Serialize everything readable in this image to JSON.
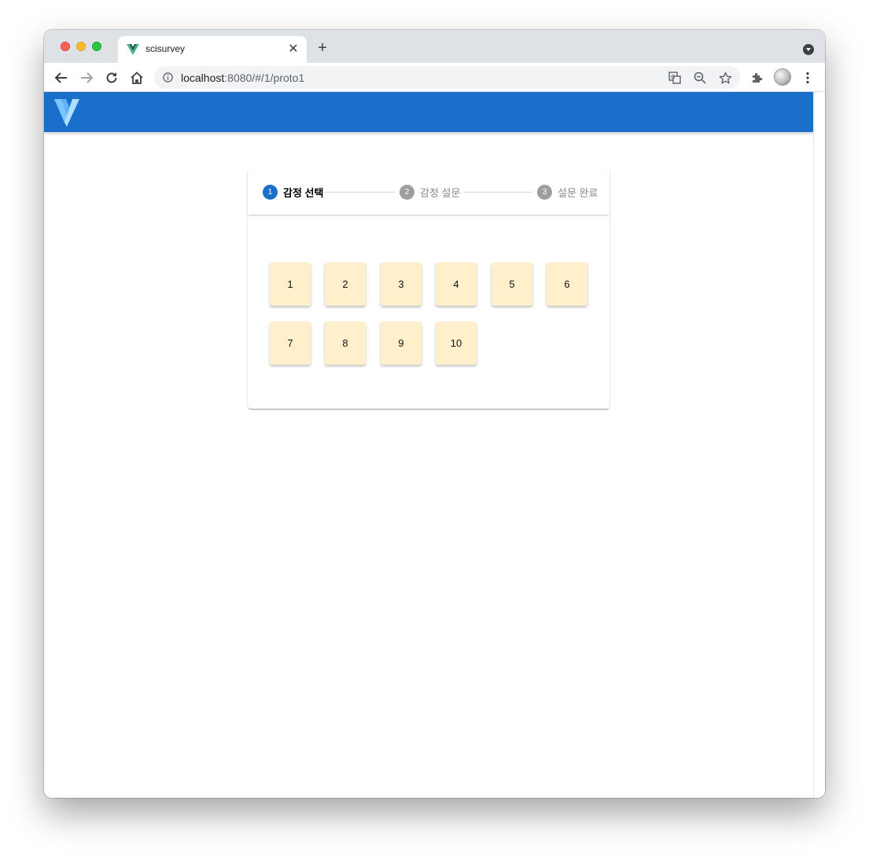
{
  "browser": {
    "tab": {
      "title": "scisurvey",
      "close_glyph": "✕"
    },
    "new_tab_glyph": "+",
    "url": {
      "host": "localhost",
      "rest": ":8080/#/1/proto1"
    },
    "icons": [
      "back-arrow-icon",
      "forward-arrow-icon",
      "reload-icon",
      "home-icon",
      "site-info-icon",
      "translate-icon",
      "zoom-out-icon",
      "bookmark-star-icon",
      "extensions-icon",
      "profile-avatar",
      "menu-kebab-icon",
      "tab-search-icon"
    ]
  },
  "app": {
    "header_color": "#1a6fca",
    "stepper": {
      "steps": [
        {
          "number": "1",
          "label": "감정 선택",
          "state": "active"
        },
        {
          "number": "2",
          "label": "감정 설문",
          "state": "inactive"
        },
        {
          "number": "3",
          "label": "설문 완료",
          "state": "inactive"
        }
      ]
    },
    "options": [
      "1",
      "2",
      "3",
      "4",
      "5",
      "6",
      "7",
      "8",
      "9",
      "10"
    ],
    "option_color": "#ffefcb"
  }
}
